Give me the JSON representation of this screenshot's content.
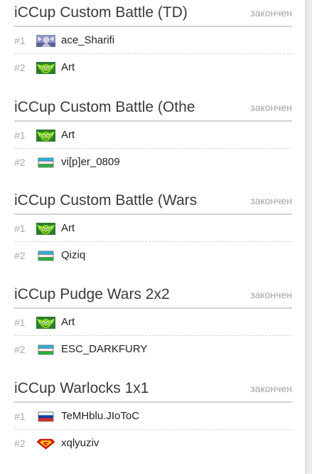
{
  "matches": [
    {
      "title": "iCCup Custom Battle (TD)",
      "status": "закончен",
      "players": [
        {
          "rank": "#1",
          "name": "ace_Sharifi",
          "icon": "portrait-avatar-icon"
        },
        {
          "rank": "#2",
          "name": "Art",
          "icon": "green-creature-avatar-icon"
        }
      ]
    },
    {
      "title": "iCCup Custom Battle (Othe",
      "status": "закончен",
      "players": [
        {
          "rank": "#1",
          "name": "Art",
          "icon": "green-creature-avatar-icon"
        },
        {
          "rank": "#2",
          "name": "vi[p]er_0809",
          "icon": "uzbekistan-flag-icon"
        }
      ]
    },
    {
      "title": "iCCup Custom Battle (Wars",
      "status": "закончен",
      "players": [
        {
          "rank": "#1",
          "name": "Art",
          "icon": "green-creature-avatar-icon"
        },
        {
          "rank": "#2",
          "name": "Qiziq",
          "icon": "uzbekistan-flag-icon"
        }
      ]
    },
    {
      "title": "iCCup Pudge Wars 2x2",
      "status": "закончен",
      "players": [
        {
          "rank": "#1",
          "name": "Art",
          "icon": "green-creature-avatar-icon"
        },
        {
          "rank": "#2",
          "name": "ESC_DARKFURY",
          "icon": "uzbekistan-flag-icon"
        }
      ]
    },
    {
      "title": "iCCup Warlocks 1x1",
      "status": "закончен",
      "players": [
        {
          "rank": "#1",
          "name": "TeMHblu.JIoToC",
          "icon": "russia-flag-icon"
        },
        {
          "rank": "#2",
          "name": "xqlyuziv",
          "icon": "superman-emblem-icon"
        }
      ]
    }
  ],
  "colors": {
    "title": "#3a3a3a",
    "status": "#a2a2a2",
    "rank": "#a9a9a9",
    "name": "#222222",
    "divider": "#d3d3d3"
  }
}
